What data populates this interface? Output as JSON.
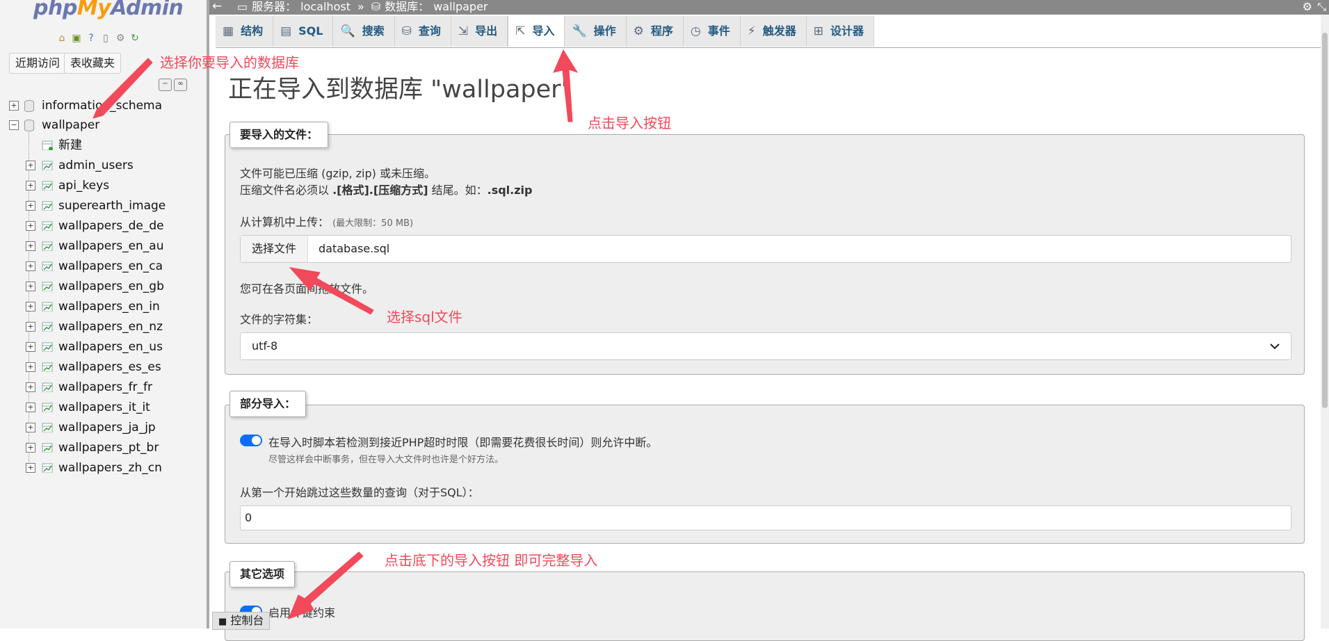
{
  "nav": {
    "logo": {
      "php": "php",
      "my": "My",
      "admin": "Admin"
    },
    "icons": [
      "home-icon",
      "database-icon",
      "help-icon",
      "doc-icon",
      "settings-icon",
      "reload-icon"
    ],
    "recent_label": "近期访问",
    "favorites_label": "表收藏夹",
    "databases": [
      {
        "name": "information_schema",
        "expanded": false
      },
      {
        "name": "wallpaper",
        "expanded": true
      }
    ],
    "new_label": "新建",
    "tables": [
      "admin_users",
      "api_keys",
      "superearth_image",
      "wallpapers_de_de",
      "wallpapers_en_au",
      "wallpapers_en_ca",
      "wallpapers_en_gb",
      "wallpapers_en_in",
      "wallpapers_en_nz",
      "wallpapers_en_us",
      "wallpapers_es_es",
      "wallpapers_fr_fr",
      "wallpapers_it_it",
      "wallpapers_ja_jp",
      "wallpapers_pt_br",
      "wallpapers_zh_cn"
    ]
  },
  "topbar": {
    "server_label": "服务器：",
    "server": "localhost",
    "separator": "»",
    "db_label": "数据库：",
    "db": "wallpaper"
  },
  "tabs": [
    {
      "label": "结构",
      "icon": "structure-icon",
      "glyph": "▦"
    },
    {
      "label": "SQL",
      "icon": "sql-icon",
      "glyph": "▤"
    },
    {
      "label": "搜索",
      "icon": "search-icon",
      "glyph": "🔍"
    },
    {
      "label": "查询",
      "icon": "query-icon",
      "glyph": "⛁"
    },
    {
      "label": "导出",
      "icon": "export-icon",
      "glyph": "⇲"
    },
    {
      "label": "导入",
      "icon": "import-icon",
      "glyph": "⇱",
      "active": true
    },
    {
      "label": "操作",
      "icon": "wrench-icon",
      "glyph": "🔧"
    },
    {
      "label": "程序",
      "icon": "routines-icon",
      "glyph": "⚙"
    },
    {
      "label": "事件",
      "icon": "clock-icon",
      "glyph": "◷"
    },
    {
      "label": "触发器",
      "icon": "trigger-icon",
      "glyph": "⚡"
    },
    {
      "label": "设计器",
      "icon": "designer-icon",
      "glyph": "⊞"
    }
  ],
  "page_title": "正在导入到数据库 \"wallpaper\"",
  "file_section": {
    "legend": "要导入的文件：",
    "compress_line1": "文件可能已压缩 (gzip, zip) 或未压缩。",
    "compress_line2_pre": "压缩文件名必须以 ",
    "compress_line2_bold": ".[格式].[压缩方式]",
    "compress_line2_mid": " 结尾。如：",
    "compress_line2_ex": ".sql.zip",
    "upload_label": "从计算机中上传：",
    "upload_limit": "(最大限制：50 MB)",
    "choose_file_button": "选择文件",
    "file_name": "database.sql",
    "drag_hint": "您可在各页面间拖放文件。",
    "charset_label": "文件的字符集：",
    "charset_value": "utf-8"
  },
  "partial_section": {
    "legend": "部分导入：",
    "allow_interrupt_label": "在导入时脚本若检测到接近PHP超时时限（即需要花费很长时间）则允许中断。",
    "allow_interrupt_checked": true,
    "interrupt_hint": "尽管这样会中断事务，但在导入大文件时也许是个好方法。",
    "skip_label": "从第一个开始跳过这些数量的查询（对于SQL）：",
    "skip_value": "0"
  },
  "other_section": {
    "legend": "其它选项",
    "foreign_key_label": "启用外键约束",
    "foreign_key_checked": true
  },
  "console_label": "控制台",
  "annotations": {
    "select_db": "选择你要导入的数据库",
    "click_import": "点击导入按钮",
    "choose_sql": "选择sql文件",
    "bottom_import": "点击底下的导入按钮 即可完整导入"
  },
  "colors": {
    "annotation": "#f2495b",
    "tab_text": "#235a81",
    "toggle_on": "#0d6efd"
  }
}
